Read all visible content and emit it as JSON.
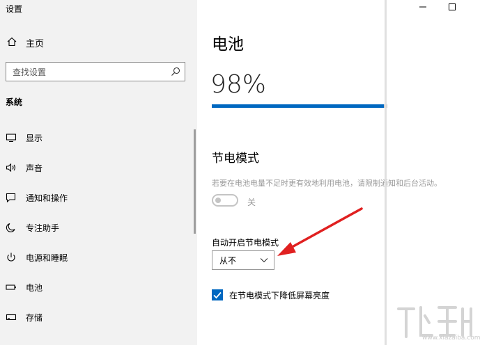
{
  "app": {
    "title": "设置"
  },
  "window": {
    "minimize_icon": "minimize-icon",
    "maximize_icon": "maximize-icon"
  },
  "sidebar": {
    "home": {
      "label": "主页",
      "icon": "home-icon"
    },
    "search": {
      "placeholder": "查找设置",
      "icon": "search-icon"
    },
    "section": "系统",
    "items": [
      {
        "label": "显示",
        "icon": "display-icon"
      },
      {
        "label": "声音",
        "icon": "speaker-icon"
      },
      {
        "label": "通知和操作",
        "icon": "notification-icon"
      },
      {
        "label": "专注助手",
        "icon": "moon-icon"
      },
      {
        "label": "电源和睡眠",
        "icon": "power-icon"
      },
      {
        "label": "电池",
        "icon": "battery-icon"
      },
      {
        "label": "存储",
        "icon": "storage-icon"
      }
    ]
  },
  "main": {
    "title": "电池",
    "battery_percent": "98%",
    "battery_level": 0.98,
    "saver": {
      "title": "节电模式",
      "description": "若要在电池电量不足时更有效地利用电池，请限制通知和后台活动。",
      "toggle_state": "关",
      "auto_label": "自动开启节电模式",
      "auto_value": "从不",
      "brightness_checkbox": {
        "label": "在节电模式下降低屏幕亮度",
        "checked": true
      }
    }
  },
  "accent_color": "#0067c0",
  "watermark": {
    "text": "www.xiazaiba.com"
  }
}
